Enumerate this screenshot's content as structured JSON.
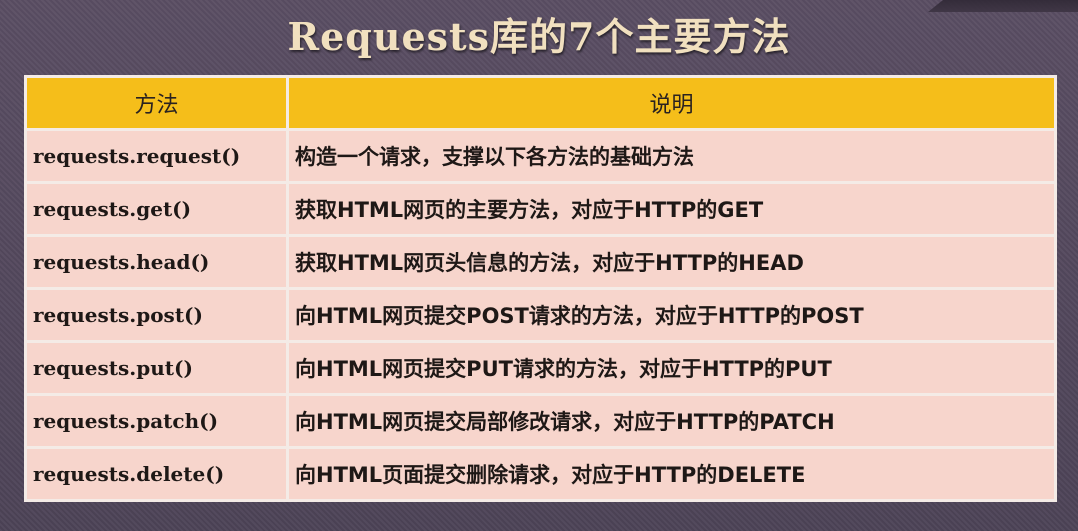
{
  "title": "Requests库的7个主要方法",
  "table": {
    "headers": [
      "方法",
      "说明"
    ],
    "rows": [
      {
        "method": "requests.request()",
        "desc": "构造一个请求，支撑以下各方法的基础方法"
      },
      {
        "method": "requests.get()",
        "desc": "获取HTML网页的主要方法，对应于HTTP的GET"
      },
      {
        "method": "requests.head()",
        "desc": "获取HTML网页头信息的方法，对应于HTTP的HEAD"
      },
      {
        "method": "requests.post()",
        "desc": "向HTML网页提交POST请求的方法，对应于HTTP的POST"
      },
      {
        "method": "requests.put()",
        "desc": "向HTML网页提交PUT请求的方法，对应于HTTP的PUT"
      },
      {
        "method": "requests.patch()",
        "desc": "向HTML网页提交局部修改请求，对应于HTTP的PATCH"
      },
      {
        "method": "requests.delete()",
        "desc": "向HTML页面提交删除请求，对应于HTTP的DELETE"
      }
    ]
  },
  "colors": {
    "background": "#544a5d",
    "title": "#f1e0bf",
    "header": "#f5be1a",
    "cell": "#f7d5cc"
  }
}
